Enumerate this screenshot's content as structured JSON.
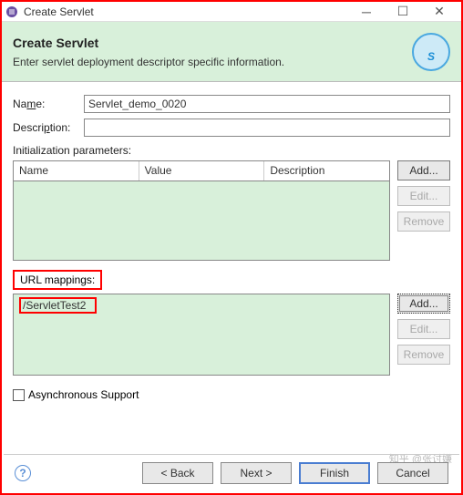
{
  "titlebar": {
    "title": "Create Servlet"
  },
  "header": {
    "title": "Create Servlet",
    "subtitle": "Enter servlet deployment descriptor specific information."
  },
  "fields": {
    "name_label_prefix": "Na",
    "name_label_u": "m",
    "name_label_suffix": "e:",
    "name_value": "Servlet_demo_0020",
    "desc_label_prefix": "Descri",
    "desc_label_u": "p",
    "desc_label_suffix": "tion:",
    "desc_value": ""
  },
  "init_params": {
    "label_u": "I",
    "label_rest": "nitialization parameters:",
    "cols": {
      "name": "Name",
      "value": "Value",
      "desc": "Description"
    },
    "buttons": {
      "add": "Add...",
      "edit": "Edit...",
      "remove": "Remove"
    }
  },
  "url_mappings": {
    "label_u": "U",
    "label_rest": "RL mappings:",
    "items": [
      "/ServletTest2"
    ],
    "buttons": {
      "add": "Add...",
      "edit": "Edit...",
      "remove": "Remove"
    }
  },
  "async": {
    "label_u": "A",
    "label_rest": "synchronous Support",
    "checked": false
  },
  "footer": {
    "back": "< Back",
    "next": "Next >",
    "finish": "Finish",
    "cancel": "Cancel"
  },
  "watermark": "知乎 @张讨嫌"
}
